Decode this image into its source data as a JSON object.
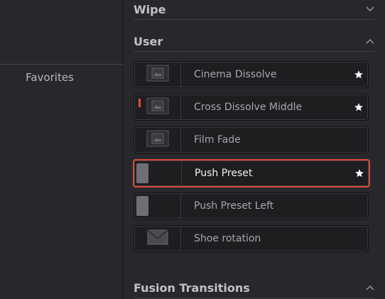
{
  "left_panel": {
    "favorites_label": "Favorites"
  },
  "sections": {
    "wipe": {
      "label": "Wipe",
      "expanded": false
    },
    "user": {
      "label": "User",
      "expanded": true
    },
    "fusion": {
      "label": "Fusion Transitions",
      "expanded": true
    }
  },
  "user_items": [
    {
      "label": "Cinema Dissolve",
      "favorite": true,
      "thumbnail": "image-icon",
      "selected": false
    },
    {
      "label": "Cross Dissolve Middle",
      "favorite": true,
      "thumbnail": "image-icon",
      "selected": false
    },
    {
      "label": "Film Fade",
      "favorite": false,
      "thumbnail": "image-icon",
      "selected": false
    },
    {
      "label": "Push Preset",
      "favorite": true,
      "thumbnail": "push-bar",
      "selected": true
    },
    {
      "label": "Push Preset Left",
      "favorite": false,
      "thumbnail": "push-bar",
      "selected": false
    },
    {
      "label": "Shoe rotation",
      "favorite": false,
      "thumbnail": "envelope-icon",
      "selected": false
    }
  ],
  "colors": {
    "background": "#28282c",
    "item_background": "#1e1e21",
    "selection_border": "#d8493a",
    "marker_red": "#e24c3c"
  }
}
